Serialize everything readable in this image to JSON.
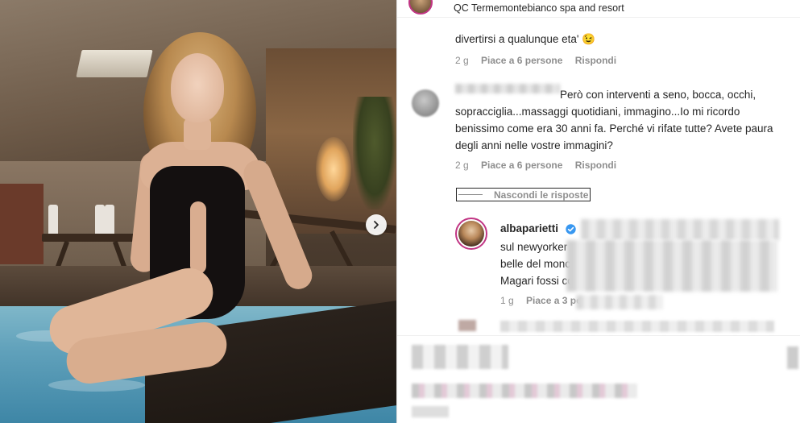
{
  "post": {
    "location": "QC Termemontebianco spa and resort"
  },
  "comments": [
    {
      "text": "divertirsi a qualunque eta' 😉",
      "time": "2 g",
      "likes": "Piace a 6 persone",
      "reply_label": "Rispondi"
    },
    {
      "text": "Però con interventi a seno, bocca, occhi, sopracciglia...massaggi quotidiani, immagino...Io mi ricordo benissimo come era 30 anni fa. Perché vi rifate tutte? Avete paura degli anni nelle vostre immagini?",
      "time": "2 g",
      "likes": "Piace a 6 persone",
      "reply_label": "Rispondi"
    }
  ],
  "hide_replies_label": "Nascondi le risposte",
  "reply": {
    "username": "albaparietti",
    "text": "sul newyorker",
    "line2": "belle del monc",
    "line3": "Magari fossi co",
    "time": "1 g",
    "likes": "Piace a 3 pe"
  },
  "colors": {
    "meta_gray": "#8e8e8e",
    "story_ring": "#c13584",
    "verified_blue": "#3897f0"
  }
}
